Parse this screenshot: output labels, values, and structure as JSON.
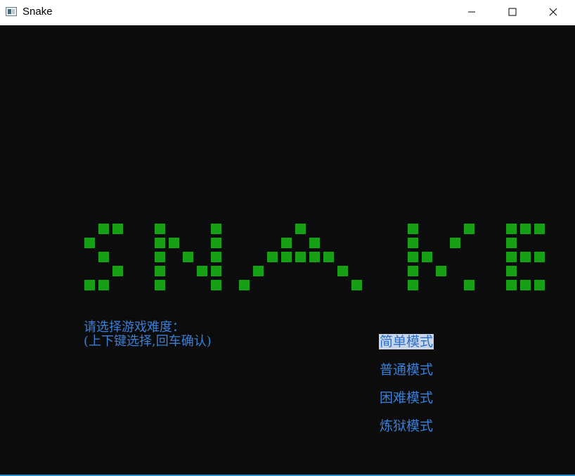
{
  "window": {
    "title": "Snake",
    "icon": "console-app-icon",
    "controls": [
      "minimize-icon",
      "maximize-icon",
      "close-icon"
    ]
  },
  "colors": {
    "background": "#0c0c0c",
    "logo_block": "#16a016",
    "text": "#3a7fd6",
    "selection_bg": "#c9d6e8"
  },
  "logo": {
    "word": "SNAKE",
    "grid": [
      "...##..#...#.....#.......#...#..###",
      "..#....##..#....#.#......#..#...#..",
      "...#...#.#.#...#####.....##.....###",
      "....#..#..##..#.....#....#.#....#..",
      "..##...#...#.#.......#...#...#..###"
    ]
  },
  "prompt": {
    "line1": "请选择游戏难度：",
    "line2": "(上下键选择,回车确认)"
  },
  "menu": {
    "selected_index": 0,
    "items": [
      {
        "label": "简单模式"
      },
      {
        "label": "普通模式"
      },
      {
        "label": "困难模式"
      },
      {
        "label": "炼狱模式"
      }
    ]
  }
}
